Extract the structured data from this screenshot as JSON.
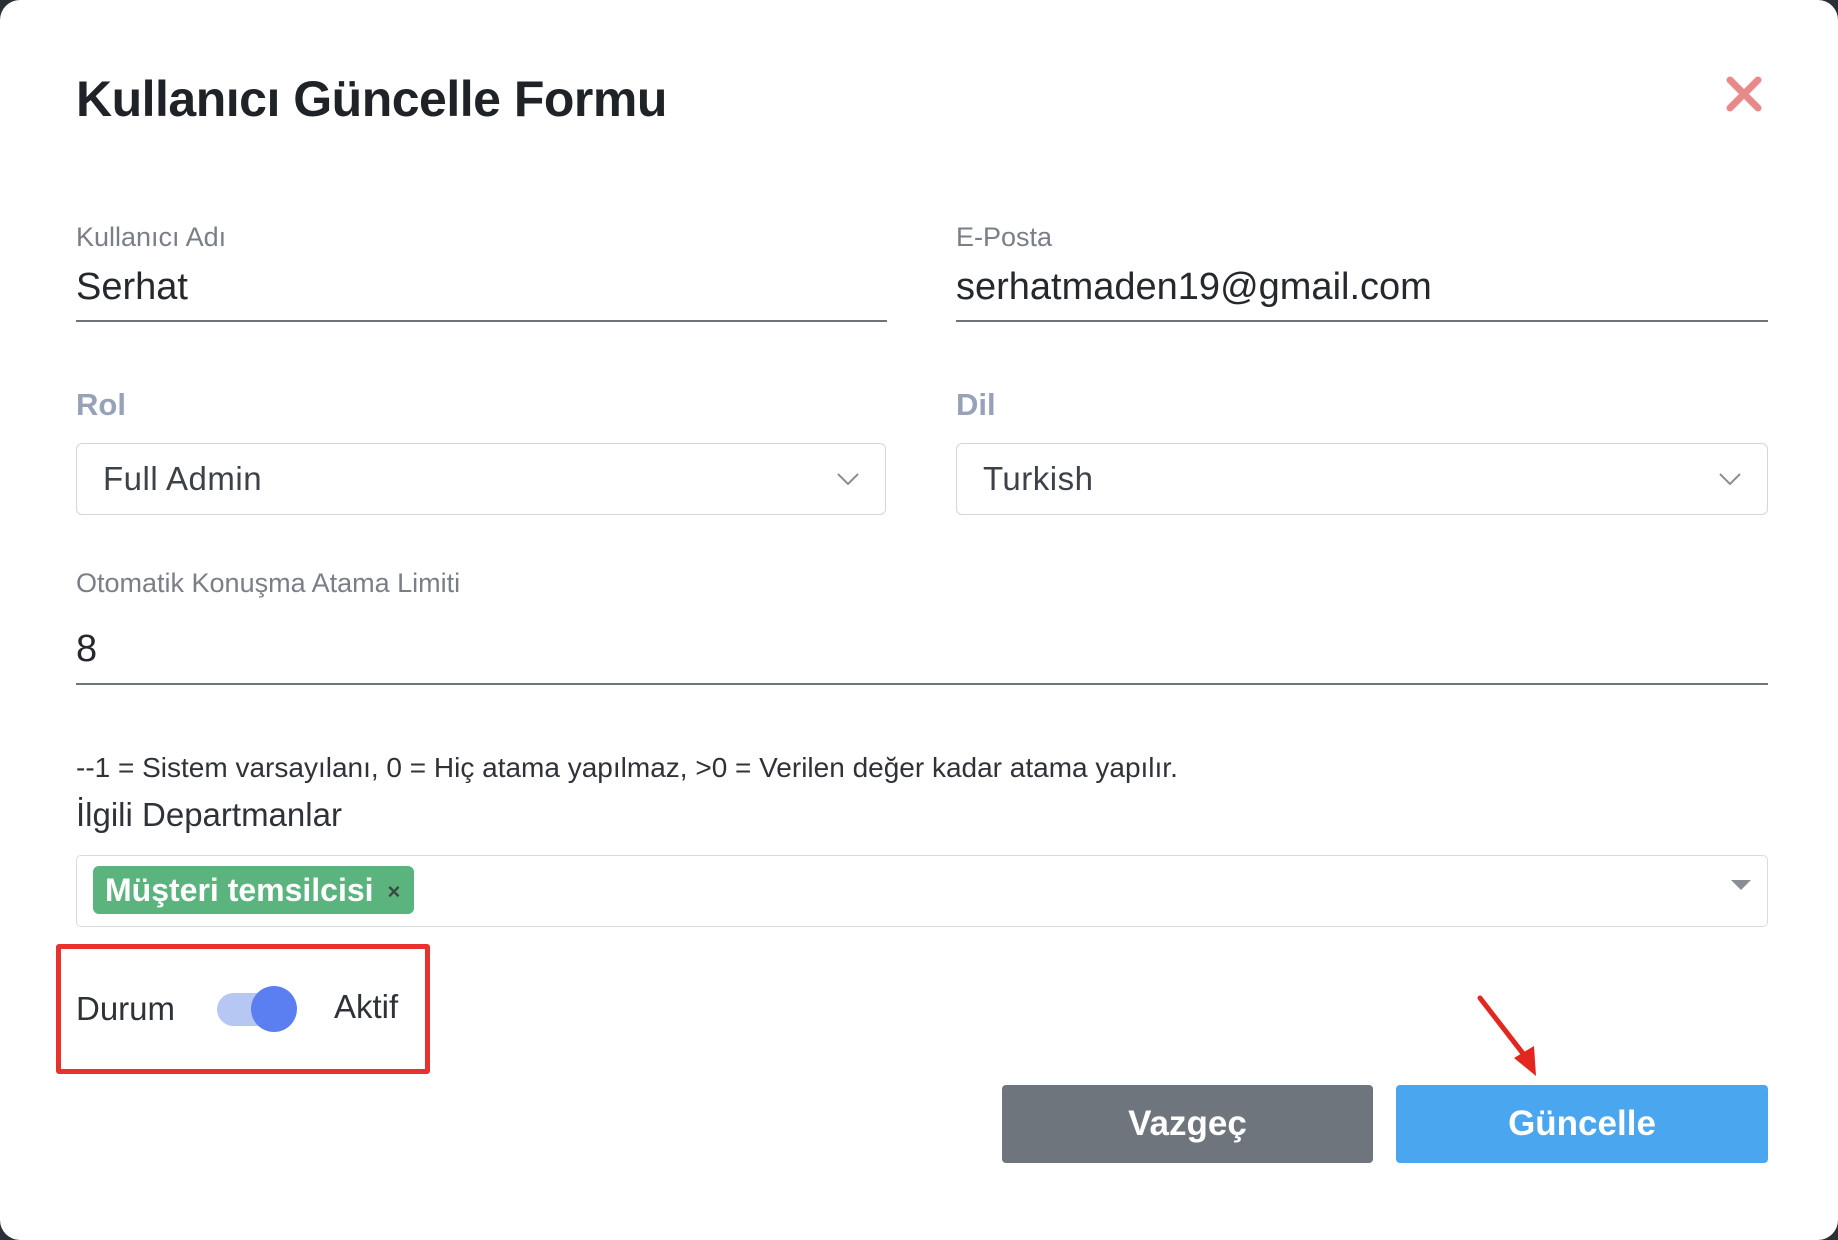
{
  "modal": {
    "title": "Kullanıcı Güncelle Formu"
  },
  "form": {
    "username": {
      "label": "Kullanıcı Adı",
      "value": "Serhat"
    },
    "email": {
      "label": "E-Posta",
      "value": "serhatmaden19@gmail.com"
    },
    "role": {
      "label": "Rol",
      "value": "Full Admin"
    },
    "language": {
      "label": "Dil",
      "value": "Turkish"
    },
    "auto_assign_limit": {
      "label": "Otomatik Konuşma Atama Limiti",
      "value": "8"
    },
    "hint": "--1 = Sistem varsayılanı, 0 = Hiç atama yapılmaz, >0 = Verilen değer kadar atama yapılır.",
    "departments": {
      "label": "İlgili Departmanlar",
      "tags": [
        "Müşteri temsilcisi"
      ],
      "tag_remove": "×"
    },
    "status": {
      "label": "Durum",
      "value": "Aktif",
      "enabled": true
    }
  },
  "buttons": {
    "cancel": "Vazgeç",
    "update": "Güncelle"
  },
  "colors": {
    "accent": "#4aa6ee",
    "cancel": "#6e757d",
    "tag": "#5bb47e",
    "toggle": "#5b7ff0",
    "highlight": "#e8322e",
    "close": "#e88a8a"
  },
  "icons": {
    "close": "close-icon",
    "select_chevron": "chevron-down-icon",
    "multiselect_caret": "caret-down-icon",
    "annotation_arrow": "arrow-icon"
  }
}
